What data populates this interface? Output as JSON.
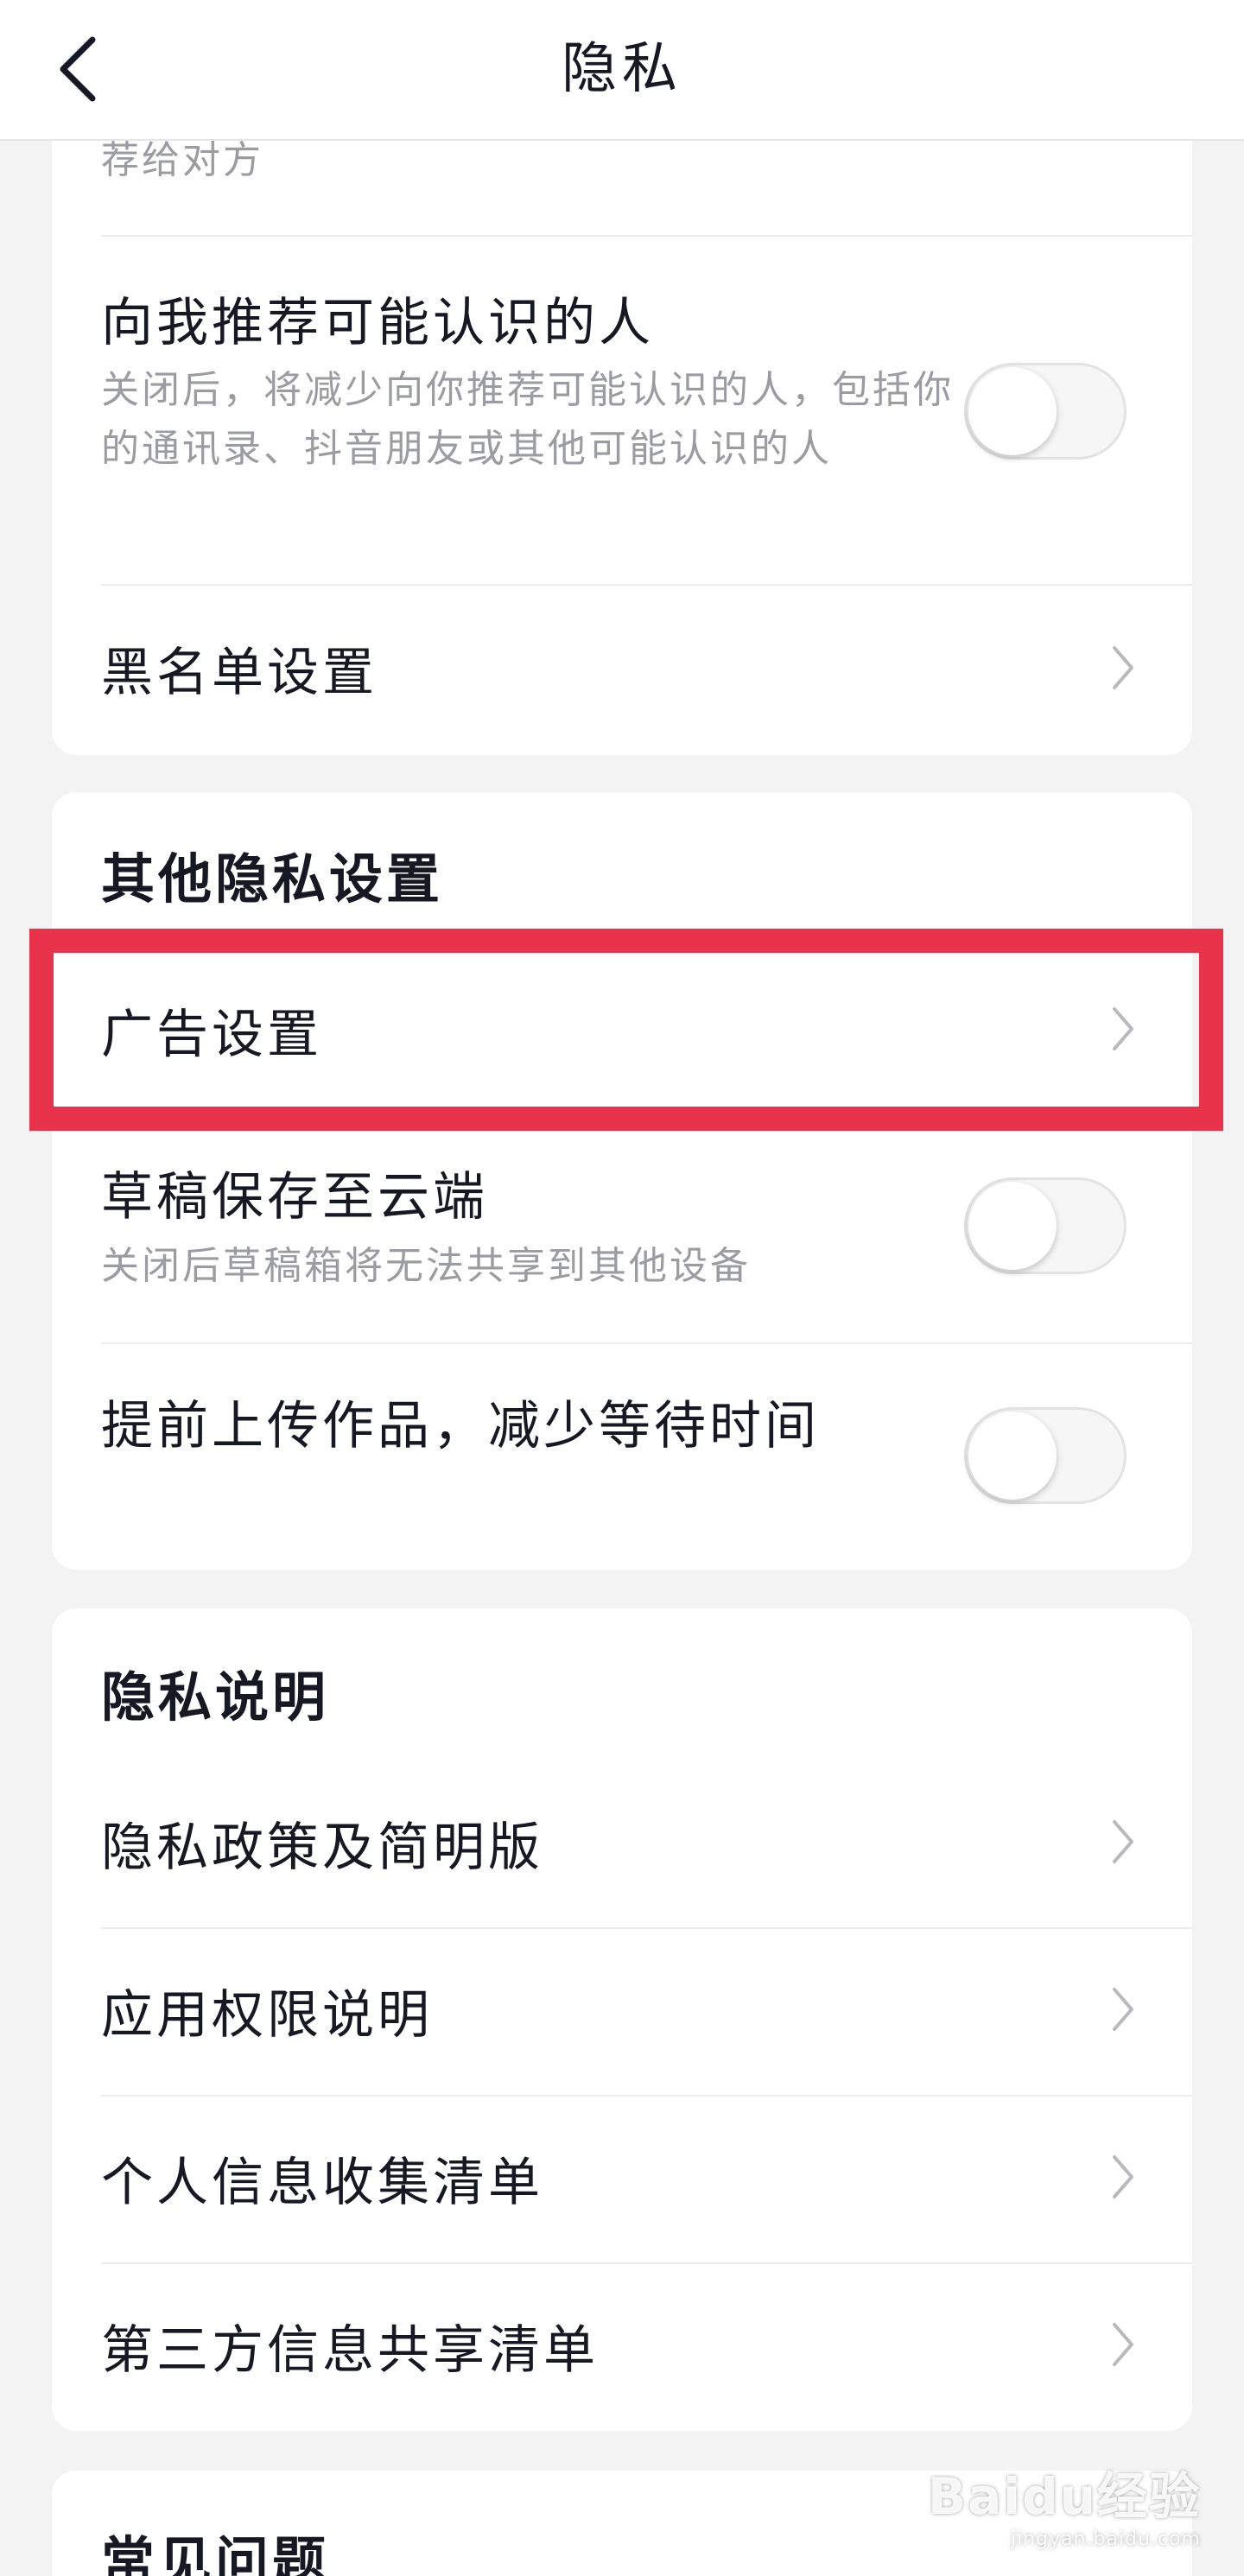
{
  "header": {
    "title": "隐私"
  },
  "section_top": {
    "partial_desc": "荐给对方",
    "recommend": {
      "title": "向我推荐可能认识的人",
      "desc": "关闭后，将减少向你推荐可能认识的人，包括你的通讯录、抖音朋友或其他可能认识的人",
      "toggle_on": false
    },
    "blacklist": {
      "title": "黑名单设置"
    }
  },
  "section_other": {
    "title": "其他隐私设置",
    "ad_settings": {
      "title": "广告设置"
    },
    "draft_cloud": {
      "title": "草稿保存至云端",
      "desc": "关闭后草稿箱将无法共享到其他设备",
      "toggle_on": false
    },
    "pre_upload": {
      "title": "提前上传作品，减少等待时间",
      "toggle_on": false
    }
  },
  "section_privacy_notes": {
    "title": "隐私说明",
    "items": [
      {
        "label": "隐私政策及简明版"
      },
      {
        "label": "应用权限说明"
      },
      {
        "label": "个人信息收集清单"
      },
      {
        "label": "第三方信息共享清单"
      }
    ]
  },
  "section_faq": {
    "title": "常见问题"
  },
  "highlight_color": "#e8334a",
  "watermark": {
    "main": "Baidu经验",
    "sub": "jingyan.baidu.com"
  }
}
